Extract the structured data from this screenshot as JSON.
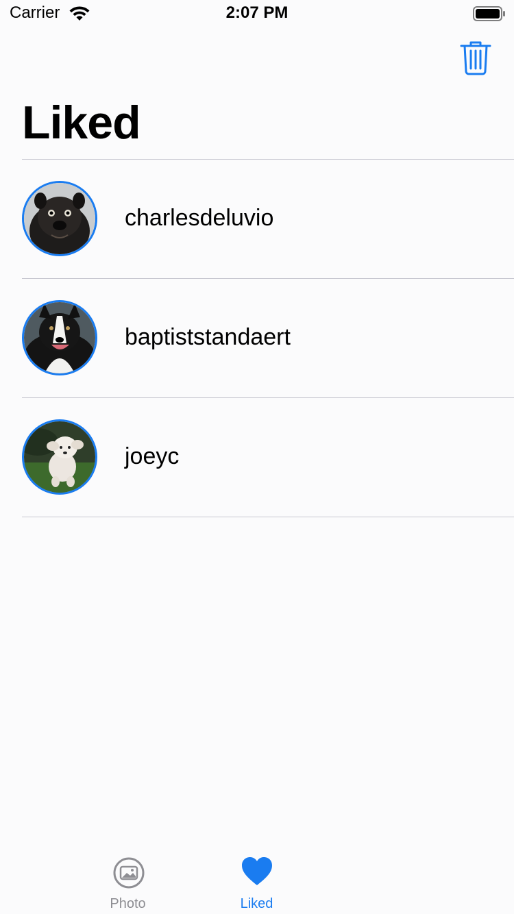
{
  "status_bar": {
    "carrier": "Carrier",
    "time": "2:07 PM"
  },
  "nav": {
    "title": "Liked",
    "trash_icon": "trash-icon"
  },
  "liked": [
    {
      "username": "charlesdeluvio",
      "avatar": "black-pug-photo"
    },
    {
      "username": "baptiststandaert",
      "avatar": "border-collie-photo"
    },
    {
      "username": "joeyc",
      "avatar": "white-running-dog-photo"
    }
  ],
  "tabs": [
    {
      "label": "Photo",
      "icon": "photo-icon",
      "selected": false
    },
    {
      "label": "Liked",
      "icon": "heart-icon",
      "selected": true
    }
  ],
  "colors": {
    "accent": "#1a7cf0",
    "inactive": "#8e8e93",
    "background": "#fbfbfc"
  }
}
